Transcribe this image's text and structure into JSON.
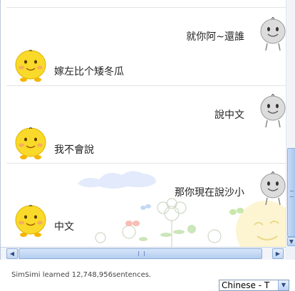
{
  "chat": {
    "messages": [
      {
        "sender": "user",
        "text": "就你阿~還誰"
      },
      {
        "sender": "simsimi",
        "text": "嫁左比个矮冬瓜"
      },
      {
        "sender": "user",
        "text": "說中文"
      },
      {
        "sender": "simsimi",
        "text": "我不會說"
      },
      {
        "sender": "user",
        "text": "那你現在說沙小"
      },
      {
        "sender": "simsimi",
        "text": "中文"
      }
    ]
  },
  "status": {
    "learned_text": "SimSimi learned 12,748,956sentences."
  },
  "language": {
    "selected": "Chinese - T"
  },
  "colors": {
    "bot_avatar": "#f9d92a",
    "user_avatar": "#d9d9d9",
    "scrollbar": "#b3cdef"
  }
}
